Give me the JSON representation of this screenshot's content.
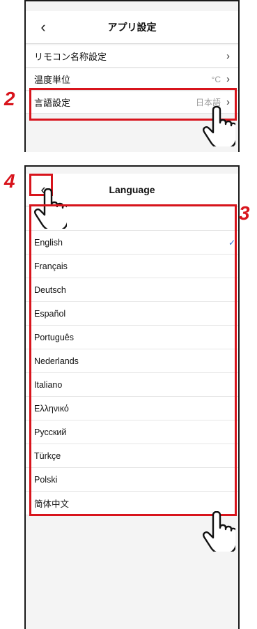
{
  "screen1": {
    "title": "アプリ設定",
    "rows": [
      {
        "label": "リモコン名称設定",
        "value": ""
      },
      {
        "label": "温度単位",
        "value": "°C"
      },
      {
        "label": "言語設定",
        "value": "日本語"
      }
    ]
  },
  "screen2": {
    "title": "Language",
    "languages": [
      "English",
      "Français",
      "Deutsch",
      "Español",
      "Português",
      "Nederlands",
      "Italiano",
      "Ελληνικό",
      "Русский",
      "Türkçe",
      "Polski",
      "简体中文"
    ],
    "selected": "English"
  },
  "callouts": {
    "c2": "2",
    "c3": "3",
    "c4": "4"
  },
  "colors": {
    "highlight": "#d8141c",
    "check": "#2f6fd8"
  },
  "icons": {
    "back": "chevron-left-icon",
    "next": "chevron-right-icon",
    "hand": "pointing-hand-icon"
  }
}
